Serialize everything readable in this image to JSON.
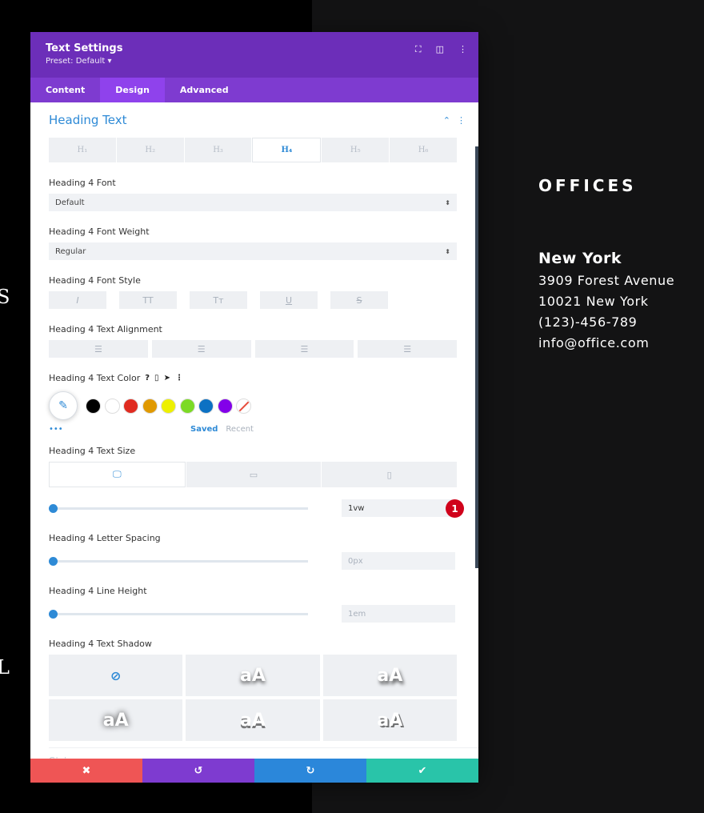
{
  "background": {
    "glyph_top": "S",
    "glyph_bottom": "L"
  },
  "offices": {
    "title": "OFFICES",
    "city": "New York",
    "address_line1": "3909 Forest Avenue",
    "address_line2": "10021 New York",
    "phone": "(123)-456-789",
    "email": "info@office.com"
  },
  "panel": {
    "title": "Text Settings",
    "preset": "Preset: Default ▾",
    "header_icons": [
      "fullscreen-icon",
      "columns-icon",
      "more-vert-icon"
    ],
    "tabs": [
      {
        "label": "Content",
        "active": false
      },
      {
        "label": "Design",
        "active": true
      },
      {
        "label": "Advanced",
        "active": false
      }
    ],
    "section_title": "Heading Text",
    "heading_tabs": [
      "H₁",
      "H₂",
      "H₃",
      "H₄",
      "H₅",
      "H₆"
    ],
    "active_heading": "H₄",
    "font": {
      "label": "Heading 4 Font",
      "value": "Default"
    },
    "font_weight": {
      "label": "Heading 4 Font Weight",
      "value": "Regular"
    },
    "font_style": {
      "label": "Heading 4 Font Style",
      "options": [
        "I",
        "TT",
        "Tт",
        "U",
        "S"
      ]
    },
    "text_alignment": {
      "label": "Heading 4 Text Alignment"
    },
    "text_color": {
      "label": "Heading 4 Text Color",
      "help": "?",
      "swatches": [
        "#000000",
        "#ffffff",
        "#e02b20",
        "#e09900",
        "#edf000",
        "#7cda24",
        "#0c71c3",
        "#8300e9"
      ],
      "saved_label": "Saved",
      "recent_label": "Recent",
      "more": "•••"
    },
    "text_size": {
      "label": "Heading 4 Text Size",
      "value": "1vw",
      "badge": "1"
    },
    "letter_spacing": {
      "label": "Heading 4 Letter Spacing",
      "value": "0px"
    },
    "line_height": {
      "label": "Heading 4 Line Height",
      "value": "1em"
    },
    "text_shadow": {
      "label": "Heading 4 Text Shadow",
      "sample": "aA"
    },
    "next_section": "Sizing",
    "accent_color": "#2e8ad6"
  },
  "footer": {
    "cancel": "✖",
    "undo": "↺",
    "redo": "↻",
    "save": "✔",
    "colors": [
      "#ef5555",
      "#7e3bd0",
      "#2b87da",
      "#29c4a9"
    ]
  }
}
